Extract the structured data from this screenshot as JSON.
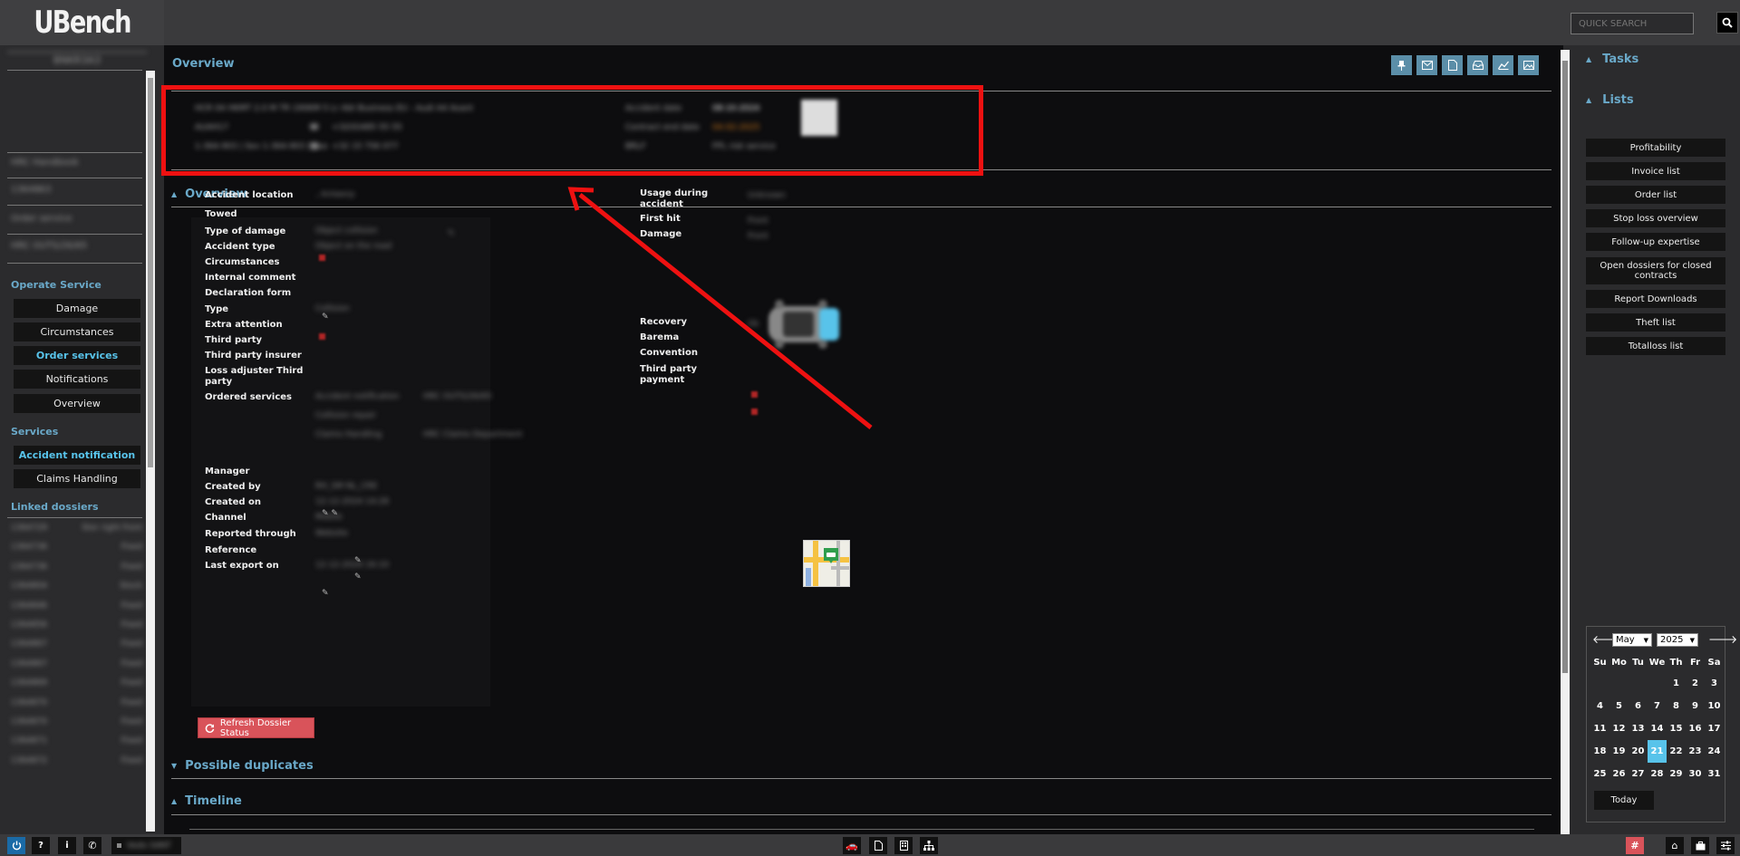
{
  "app": {
    "logo": "UBench"
  },
  "search": {
    "placeholder": "QUICK SEARCH"
  },
  "sidebar": {
    "user": "BNKR3A3",
    "blurred_items": [
      "HRC Handbook",
      "1364863",
      "Order service",
      "HRC OUTS/26/65"
    ],
    "operate_service": {
      "title": "Operate Service",
      "items": [
        "Damage",
        "Circumstances",
        "Order services",
        "Notifications",
        "Overview"
      ]
    },
    "services": {
      "title": "Services",
      "items": [
        "Accident notification",
        "Claims Handling"
      ]
    },
    "linked_dossiers": {
      "title": "Linked dossiers",
      "rows": [
        [
          "1364729",
          "Stor right front"
        ],
        [
          "1364736",
          "Fixed"
        ],
        [
          "1364736",
          "Fixed"
        ],
        [
          "1364804",
          "Stock"
        ],
        [
          "1364846",
          "Fixed"
        ],
        [
          "1364856",
          "Fixed"
        ],
        [
          "1364867",
          "Fixed"
        ],
        [
          "1364867",
          "Fixed"
        ],
        [
          "1364869",
          "Fixed"
        ],
        [
          "1364870",
          "Fixed"
        ],
        [
          "1364870",
          "Fixed"
        ],
        [
          "1364871",
          "Fixed"
        ],
        [
          "1364872",
          "Fixed"
        ]
      ]
    }
  },
  "main": {
    "title": "Overview",
    "toolbar_icons": [
      "pin-icon",
      "mail-icon",
      "document-icon",
      "inbox-icon",
      "chart-icon",
      "image-icon"
    ],
    "summary": {
      "line1": "HCR 04 HKMT 2.0 M TR 190KM 5 Lr Abt Business EU - Audi A4 Avant",
      "line2a": "AUAH17",
      "line2b": "+32(0)485 55 55",
      "line3a": "1-364-903 | Sev 1-364-903 | pax",
      "line3b": "+32 15 756 077",
      "right1_label": "Accident date",
      "right1_val": "08-10-2024",
      "right2_label": "Contract end date",
      "right2_val": "04-02-2025",
      "right3_label": "BRLF",
      "right3_val": "FPL risk service"
    },
    "overview": {
      "title": "Overview",
      "left_fields": [
        {
          "label": "Accident location",
          "value": ", Antwerp"
        },
        {
          "label": "Towed",
          "value": ""
        },
        {
          "label": "Type of damage",
          "value": "Object collision"
        },
        {
          "label": "Accident type",
          "value": "Object on the road"
        },
        {
          "label": "Circumstances",
          "value": ""
        },
        {
          "label": "Internal comment",
          "value": ""
        },
        {
          "label": "Declaration form",
          "value": ""
        },
        {
          "label": "Type",
          "value": "Collision"
        },
        {
          "label": "Extra attention",
          "value": ""
        },
        {
          "label": "Third party",
          "value": ""
        },
        {
          "label": "Third party insurer",
          "value": ""
        },
        {
          "label": "Loss adjuster Third party",
          "value": ""
        },
        {
          "label": "Ordered services",
          "value": "Accident notification"
        }
      ],
      "ordered_services": [
        [
          "Accident notification",
          "HRC OUTS/26/65"
        ],
        [
          "Collision repair",
          ""
        ],
        [
          "Claims Handling",
          "HRC Claims Department"
        ]
      ],
      "bottom_fields": [
        {
          "label": "Manager",
          "value": ""
        },
        {
          "label": "Created by",
          "value": "RH_SM NL_CRE"
        },
        {
          "label": "Created on",
          "value": "12-12-2024 14:28"
        },
        {
          "label": "Channel",
          "value": "Mobile"
        },
        {
          "label": "Reported through",
          "value": "Website"
        },
        {
          "label": "Reference",
          "value": ""
        },
        {
          "label": "Last export on",
          "value": "12-12-2024 16:10"
        }
      ],
      "right_fields": [
        {
          "label": "Usage during accident",
          "value": "Unknown"
        },
        {
          "label": "First hit",
          "value": "Front"
        },
        {
          "label": "Damage",
          "value": "Front"
        },
        {
          "label": "Recovery",
          "value": "Ok"
        },
        {
          "label": "Barema",
          "value": ""
        },
        {
          "label": "Convention",
          "value": ""
        },
        {
          "label": "Third party payment",
          "value": ""
        }
      ]
    },
    "refresh_button": "Refresh Dossier Status",
    "possible_duplicates": "Possible duplicates",
    "timeline": "Timeline"
  },
  "rightpanel": {
    "tasks_title": "Tasks",
    "lists_title": "Lists",
    "lists": [
      "Profitability",
      "Invoice list",
      "Order list",
      "Stop loss overview",
      "Follow-up expertise",
      "Open dossiers for closed contracts",
      "Report Downloads",
      "Theft list",
      "Totalloss list"
    ],
    "calendar": {
      "month": "May",
      "year": "2025",
      "days_of_week": [
        "Su",
        "Mo",
        "Tu",
        "We",
        "Th",
        "Fr",
        "Sa"
      ],
      "weeks": [
        [
          "",
          "",
          "",
          "",
          "1",
          "2",
          "3"
        ],
        [
          "4",
          "5",
          "6",
          "7",
          "8",
          "9",
          "10"
        ],
        [
          "11",
          "12",
          "13",
          "14",
          "15",
          "16",
          "17"
        ],
        [
          "18",
          "19",
          "20",
          "21",
          "22",
          "23",
          "24"
        ],
        [
          "25",
          "26",
          "27",
          "28",
          "29",
          "30",
          "31"
        ]
      ],
      "selected_day": "21",
      "today_label": "Today"
    }
  },
  "bottombar": {
    "user_status": "Vedo S4NT"
  },
  "colors": {
    "accent": "#6aa9c9",
    "highlight": "#58c3ea",
    "annotation": "#ee1111",
    "danger": "#d9535a"
  }
}
